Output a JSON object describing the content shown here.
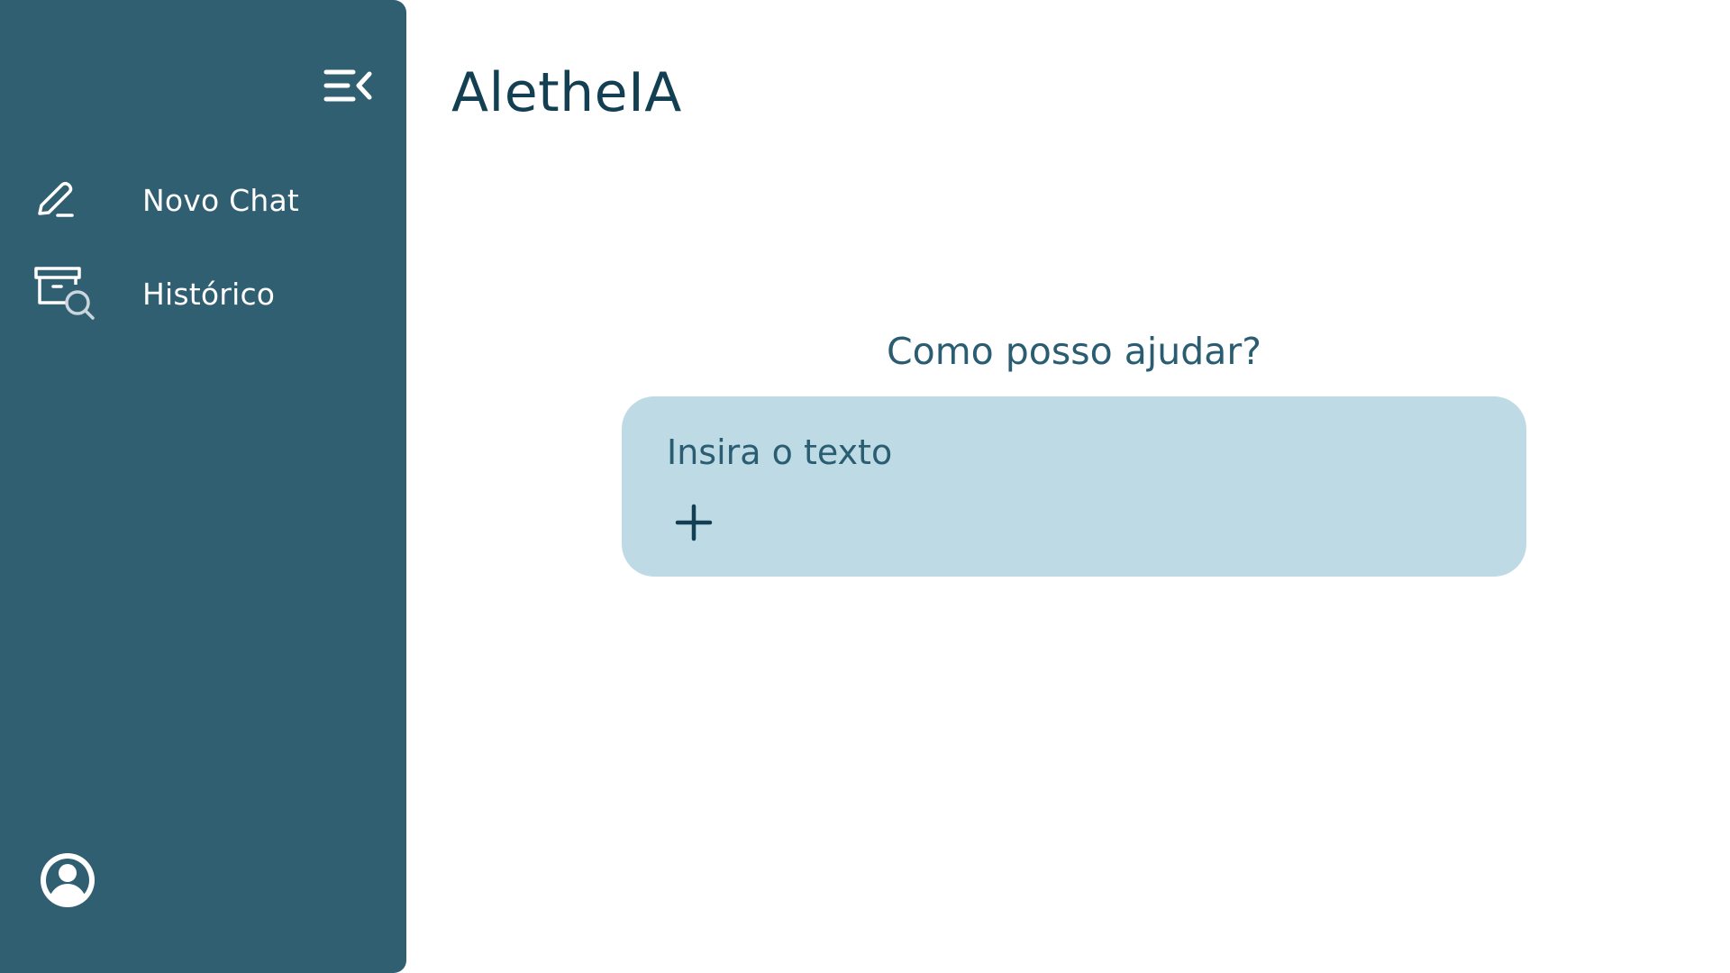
{
  "app": {
    "title": "AletheIA"
  },
  "sidebar": {
    "collapse_icon": "menu-collapse-icon",
    "items": [
      {
        "label": "Novo Chat",
        "icon": "edit-pencil-icon"
      },
      {
        "label": "Histórico",
        "icon": "archive-search-icon"
      }
    ],
    "profile_icon": "user-circle-icon"
  },
  "main": {
    "heading": "Como posso ajudar?",
    "composer": {
      "placeholder": "Insira o texto",
      "attach_icon": "plus-icon"
    }
  },
  "colors": {
    "sidebar_bg": "#305f72",
    "title": "#123f52",
    "composer_bg": "#bedbe5",
    "text_accent": "#2a5d72"
  }
}
